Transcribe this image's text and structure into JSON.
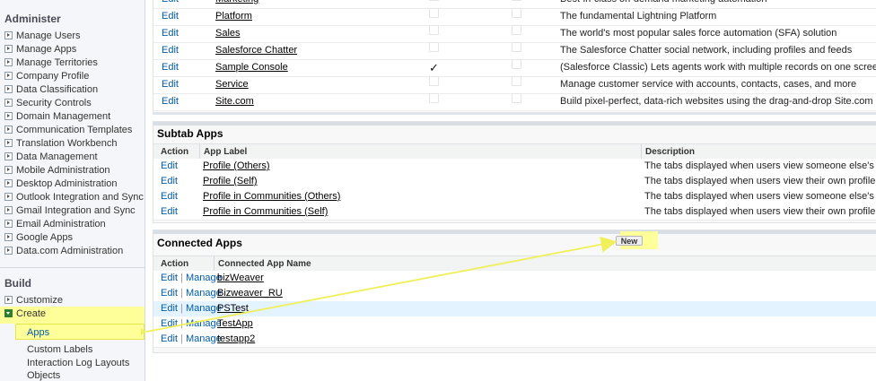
{
  "sidebar": {
    "administer_title": "Administer",
    "administer_items": [
      "Manage Users",
      "Manage Apps",
      "Manage Territories",
      "Company Profile",
      "Data Classification",
      "Security Controls",
      "Domain Management",
      "Communication Templates",
      "Translation Workbench",
      "Data Management",
      "Mobile Administration",
      "Desktop Administration",
      "Outlook Integration and Sync",
      "Gmail Integration and Sync",
      "Email Administration",
      "Google Apps",
      "Data.com Administration"
    ],
    "build_title": "Build",
    "build_items": [
      "Customize",
      "Create"
    ],
    "create_children": [
      "Apps",
      "Custom Labels",
      "Interaction Log Layouts",
      "Objects"
    ]
  },
  "apps_table": {
    "rows": [
      {
        "action": "Edit",
        "label": "Marketing",
        "managed": false,
        "description": "Best-in-class on-demand marketing automation"
      },
      {
        "action": "Edit",
        "label": "Platform",
        "managed": false,
        "description": "The fundamental Lightning Platform"
      },
      {
        "action": "Edit",
        "label": "Sales",
        "managed": false,
        "description": "The world's most popular sales force automation (SFA) solution"
      },
      {
        "action": "Edit",
        "label": "Salesforce Chatter",
        "managed": false,
        "description": "The Salesforce Chatter social network, including profiles and feeds"
      },
      {
        "action": "Edit",
        "label": "Sample Console",
        "managed": true,
        "description": "(Salesforce Classic) Lets agents work with multiple records on one screen"
      },
      {
        "action": "Edit",
        "label": "Service",
        "managed": false,
        "description": "Manage customer service with accounts, contacts, cases, and more"
      },
      {
        "action": "Edit",
        "label": "Site.com",
        "managed": false,
        "description": "Build pixel-perfect, data-rich websites using the drag-and-drop Site.com application, and"
      }
    ]
  },
  "subtab_apps": {
    "title": "Subtab Apps",
    "headers": {
      "action": "Action",
      "label": "App Label",
      "description": "Description"
    },
    "rows": [
      {
        "action": "Edit",
        "label": "Profile (Others)",
        "description": "The tabs displayed when users view someone else's profile"
      },
      {
        "action": "Edit",
        "label": "Profile (Self)",
        "description": "The tabs displayed when users view their own profile"
      },
      {
        "action": "Edit",
        "label": "Profile in Communities (Others)",
        "description": "The tabs displayed when users view someone else's profile in Co"
      },
      {
        "action": "Edit",
        "label": "Profile in Communities (Self)",
        "description": "The tabs displayed when users view their own profile in Commu"
      }
    ]
  },
  "connected_apps": {
    "title": "Connected Apps",
    "new_label": "New",
    "headers": {
      "action": "Action",
      "name": "Connected App Name"
    },
    "edit": "Edit",
    "separator": "|",
    "manage": "Manage",
    "rows": [
      {
        "name": "bizWeaver",
        "selected": false
      },
      {
        "name": "Bizweaver_RU",
        "selected": false
      },
      {
        "name": "PSTest",
        "selected": true
      },
      {
        "name": "TestApp",
        "selected": false
      },
      {
        "name": "testapp2",
        "selected": false
      }
    ]
  },
  "colors": {
    "link": "#015ba7",
    "highlight": "#ffff99",
    "annotation_arrow": "#f0f05a"
  }
}
